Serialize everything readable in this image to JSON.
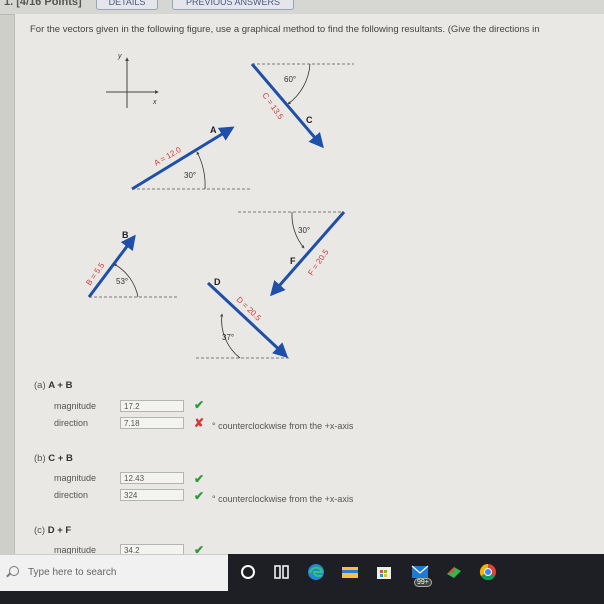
{
  "header": {
    "points": "1. [4/16 Points]",
    "details_button": "DETAILS",
    "previous_answers_button": "PREVIOUS ANSWERS"
  },
  "question": {
    "text": "For the vectors given in the following figure, use a graphical method to find the following resultants. (Give the directions in"
  },
  "figure": {
    "axes": {
      "x": "x",
      "y": "y"
    },
    "vectors": [
      {
        "id": "A",
        "label": "A",
        "magnitude_label": "A = 12.0",
        "angle_label": "30°"
      },
      {
        "id": "C",
        "label": "C",
        "magnitude_label": "C = 13.5",
        "angle_label": "60°"
      },
      {
        "id": "B",
        "label": "B",
        "magnitude_label": "B = 5.5",
        "angle_label": "53°"
      },
      {
        "id": "F",
        "label": "F",
        "magnitude_label": "F = 20.5",
        "angle_label": "30°"
      },
      {
        "id": "D",
        "label": "D",
        "magnitude_label": "D = 20.5",
        "angle_label": "37°"
      }
    ],
    "colors": {
      "vector": "#1f4fa8",
      "label_red": "#d03a3a"
    }
  },
  "parts": [
    {
      "label": "(a)",
      "expression": "A + B",
      "magnitude_label": "magnitude",
      "magnitude_value": "17.2",
      "magnitude_status": "correct",
      "direction_label": "direction",
      "direction_value": "7.18",
      "direction_status": "incorrect",
      "direction_unit": "° counterclockwise from the +x-axis"
    },
    {
      "label": "(b)",
      "expression": "C + B",
      "magnitude_label": "magnitude",
      "magnitude_value": "12.43",
      "magnitude_status": "correct",
      "direction_label": "direction",
      "direction_value": "324",
      "direction_status": "correct",
      "direction_unit": "° counterclockwise from the +x-axis"
    },
    {
      "label": "(c)",
      "expression": "D + F",
      "magnitude_label": "magnitude",
      "magnitude_value": "34.2",
      "magnitude_status": "correct"
    }
  ],
  "taskbar": {
    "search_placeholder": "Type here to search",
    "mail_badge": "99+",
    "icons": [
      "cortana-icon",
      "task-view-icon",
      "edge-icon",
      "file-explorer-icon",
      "store-icon",
      "mail-icon",
      "app-icon",
      "chrome-icon"
    ]
  }
}
